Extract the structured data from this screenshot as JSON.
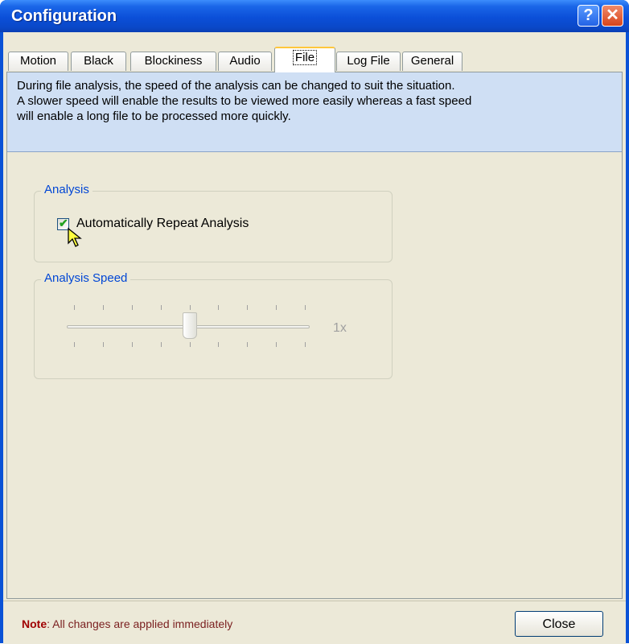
{
  "window": {
    "title": "Configuration",
    "help_label": "?",
    "close_label": "✕"
  },
  "tabs": [
    {
      "label": "Motion"
    },
    {
      "label": "Black"
    },
    {
      "label": "Blockiness"
    },
    {
      "label": "Audio"
    },
    {
      "label": "File",
      "selected": true
    },
    {
      "label": "Log File"
    },
    {
      "label": "General"
    }
  ],
  "info": {
    "line1": "During file analysis, the speed of the analysis can be changed to suit the situation.",
    "line2": "A slower speed will enable the results to be viewed more easily whereas a fast speed",
    "line3": "will enable a long file to be processed more quickly."
  },
  "analysis": {
    "group_label": "Analysis",
    "checkbox_label": "Automatically Repeat Analysis",
    "checked": true
  },
  "speed": {
    "group_label": "Analysis Speed",
    "value_label": "1x",
    "tick_count": 9,
    "position_index": 4
  },
  "footer": {
    "note_label": "Note",
    "note_text": ": All changes are applied immediately",
    "close_button": "Close"
  },
  "colors": {
    "titlebar": "#0a52d6",
    "info_bg": "#cfdff4",
    "group_label": "#0046d5",
    "note": "#a00000"
  }
}
